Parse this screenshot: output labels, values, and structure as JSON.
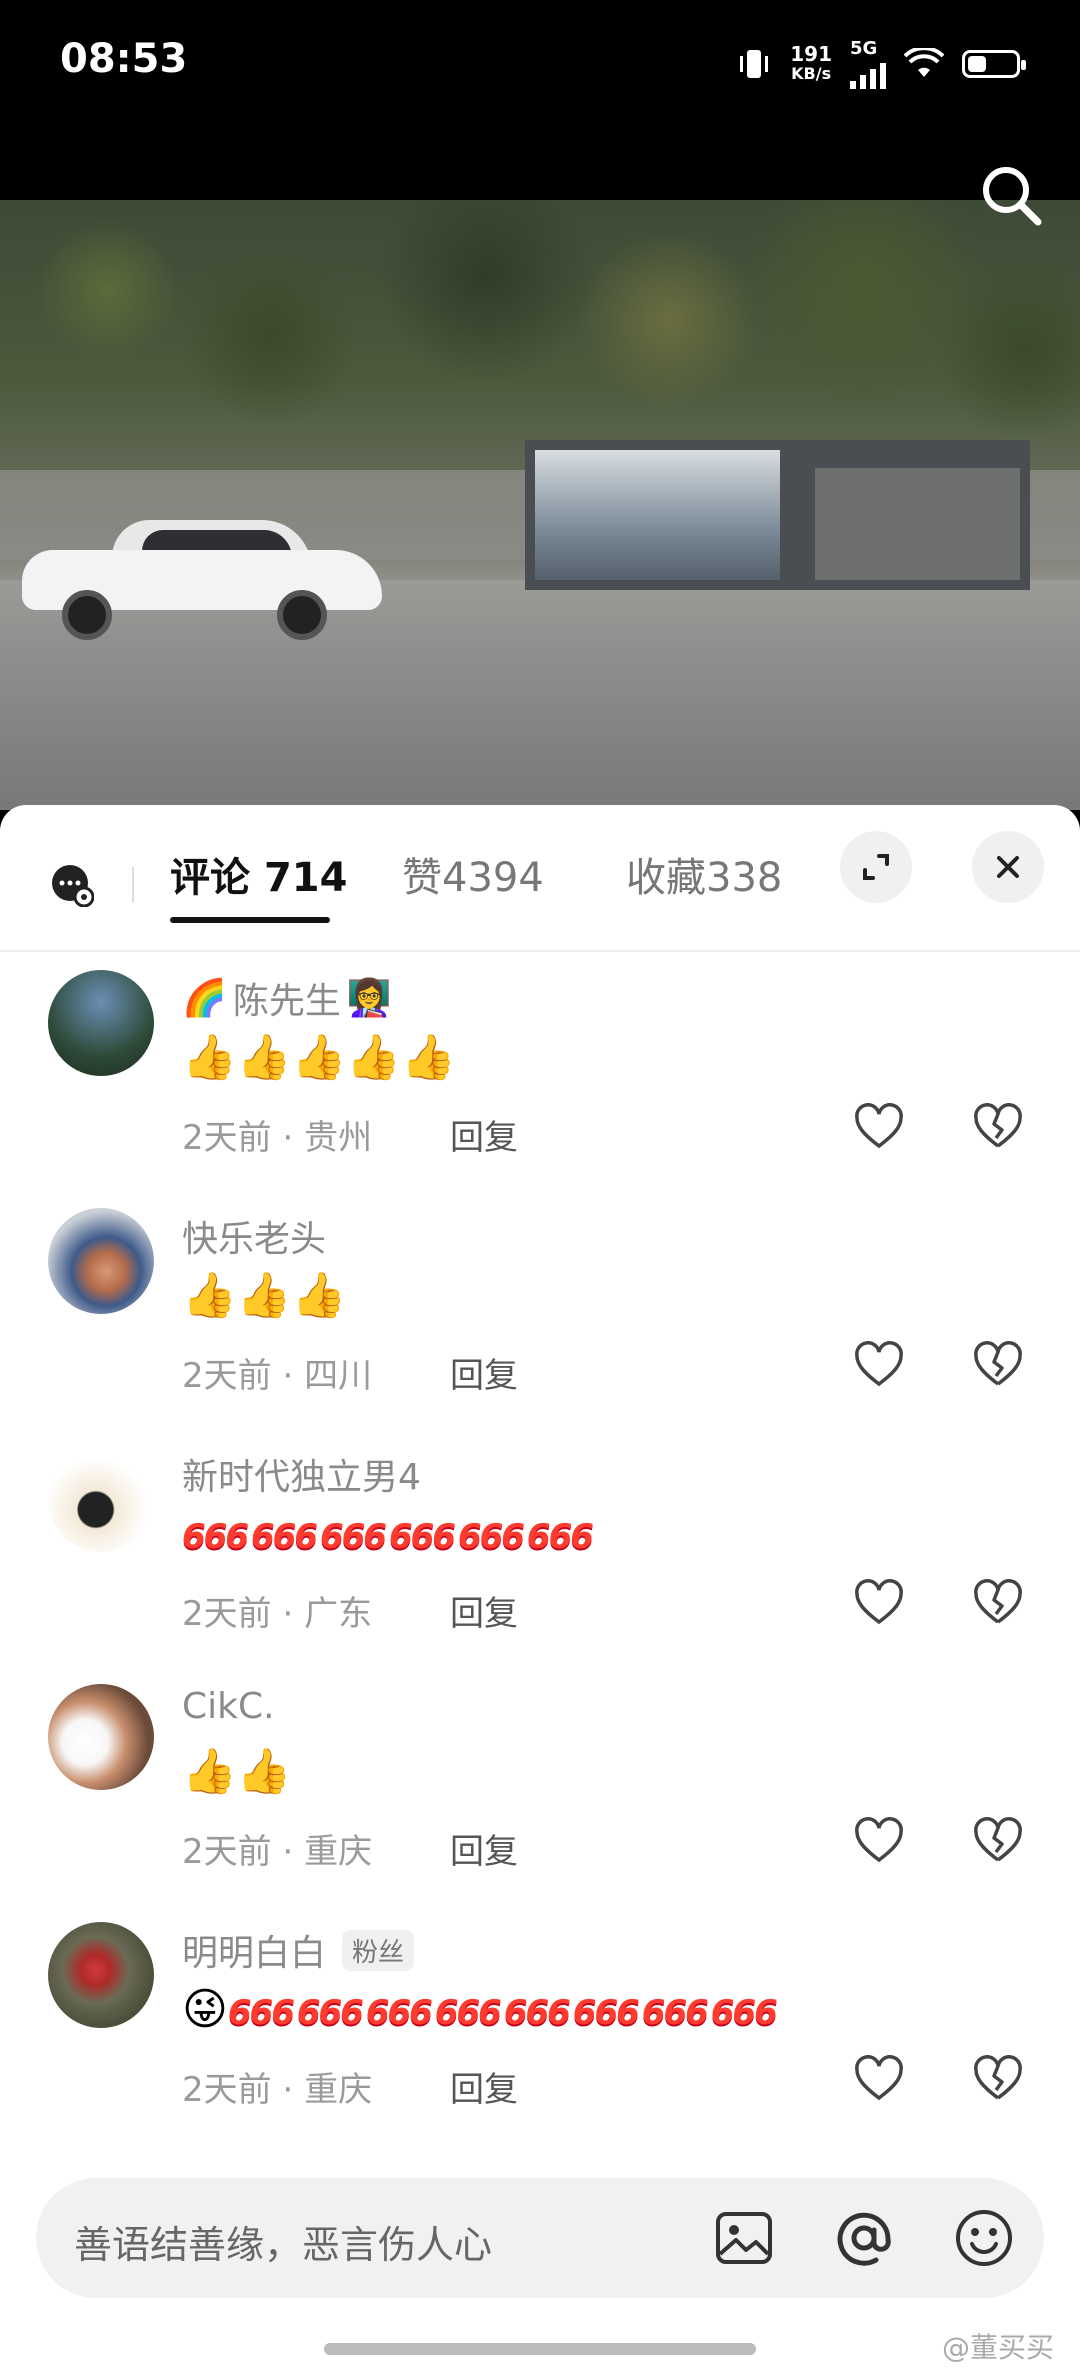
{
  "status_bar": {
    "time": "08:53",
    "net_speed": "191",
    "net_unit": "KB/s",
    "network": "5G"
  },
  "tabs": [
    {
      "label": "评论",
      "count": "714"
    },
    {
      "label": "赞",
      "count": "4394"
    },
    {
      "label": "收藏",
      "count": "338"
    }
  ],
  "comments": [
    {
      "name": "陈先生",
      "name_prefix": "🌈",
      "name_suffix": "👩‍🏫",
      "badge": "",
      "emoji": "👍👍👍👍👍",
      "emoji_666": 0,
      "time": "2天前",
      "location": "贵州",
      "reply": "回复"
    },
    {
      "name": "快乐老头",
      "name_prefix": "",
      "name_suffix": "",
      "badge": "",
      "emoji": "👍👍👍",
      "emoji_666": 0,
      "time": "2天前",
      "location": "四川",
      "reply": "回复"
    },
    {
      "name": "新时代独立男4",
      "name_prefix": "",
      "name_suffix": "",
      "badge": "",
      "emoji": "",
      "emoji_666": 6,
      "time": "2天前",
      "location": "广东",
      "reply": "回复"
    },
    {
      "name": "CikC.",
      "name_prefix": "",
      "name_suffix": "",
      "badge": "",
      "emoji": "👍👍",
      "emoji_666": 0,
      "time": "2天前",
      "location": "重庆",
      "reply": "回复"
    },
    {
      "name": "明明白白",
      "name_prefix": "",
      "name_suffix": "",
      "badge": "粉丝",
      "emoji": "😜",
      "emoji_666": 8,
      "time": "2天前",
      "location": "重庆",
      "reply": "回复"
    }
  ],
  "input": {
    "placeholder": "善语结善缘，恶言伤人心"
  },
  "watermark": "@董买买",
  "colors": {
    "accent": "#111111",
    "text_secondary": "#8a8a8a",
    "emoji_666": "#ff3b30"
  },
  "icons": [
    "search-icon",
    "chat-settings-icon",
    "expand-icon",
    "close-icon",
    "heart-icon",
    "broken-heart-icon",
    "image-icon",
    "at-icon",
    "emoji-icon"
  ]
}
